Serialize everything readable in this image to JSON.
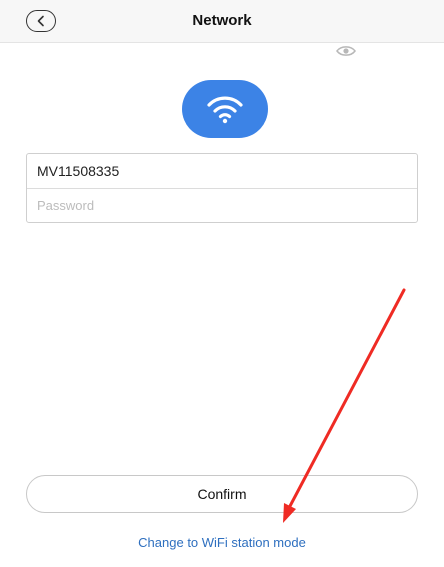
{
  "header": {
    "title": "Network",
    "back_icon": "chevron-left-icon"
  },
  "wifi_badge": {
    "icon": "wifi-icon",
    "color": "#3c83e6"
  },
  "form": {
    "ssid_value": "MV11508335",
    "password_placeholder": "Password",
    "password_value": "",
    "visibility_icon": "eye-icon"
  },
  "actions": {
    "confirm_label": "Confirm",
    "mode_link_label": "Change to WiFi station mode",
    "link_color": "#2e6fbf"
  },
  "annotation": {
    "color": "#ef2b24"
  }
}
